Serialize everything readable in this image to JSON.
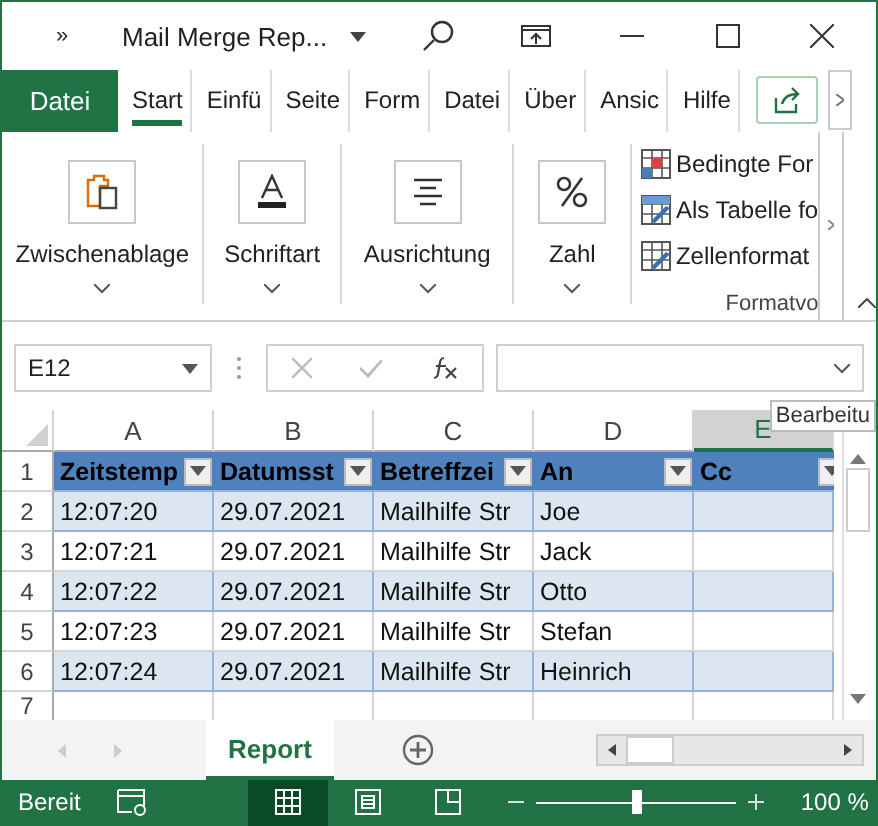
{
  "title_bar": {
    "overflow": "»",
    "title": "Mail Merge Rep..."
  },
  "ribbon_tabs": [
    {
      "label": "Datei",
      "kind": "file",
      "selected": false
    },
    {
      "label": "Start",
      "kind": "tab",
      "selected": true
    },
    {
      "label": "Einfü",
      "kind": "tab",
      "selected": false
    },
    {
      "label": "Seite",
      "kind": "tab",
      "selected": false
    },
    {
      "label": "Form",
      "kind": "tab",
      "selected": false
    },
    {
      "label": "Datei",
      "kind": "tab",
      "selected": false
    },
    {
      "label": "Über",
      "kind": "tab",
      "selected": false
    },
    {
      "label": "Ansic",
      "kind": "tab",
      "selected": false
    },
    {
      "label": "Hilfe",
      "kind": "tab",
      "selected": false
    }
  ],
  "ribbon_groups": [
    {
      "label": "Zwischenablage",
      "kind": "clipboard"
    },
    {
      "label": "Schriftart",
      "kind": "font"
    },
    {
      "label": "Ausrichtung",
      "kind": "alignment"
    },
    {
      "label": "Zahl",
      "kind": "number"
    }
  ],
  "styles_group": {
    "label": "Formatvo",
    "items": [
      {
        "label": "Bedingte For",
        "kind": "conditional"
      },
      {
        "label": "Als Tabelle fo",
        "kind": "table"
      },
      {
        "label": "Zellenformat",
        "kind": "cell"
      }
    ]
  },
  "formula_bar": {
    "name_box": "E12",
    "tooltip": "Bearbeitu"
  },
  "columns": [
    {
      "label": "A",
      "selected": false
    },
    {
      "label": "B",
      "selected": false
    },
    {
      "label": "C",
      "selected": false
    },
    {
      "label": "D",
      "selected": false
    },
    {
      "label": "E",
      "selected": true
    }
  ],
  "table": {
    "headers": [
      "Zeitstemp",
      "Datumsst",
      "Betreffzei",
      "An",
      "Cc"
    ],
    "rows": [
      {
        "number": "1",
        "kind": "header"
      },
      {
        "number": "2",
        "kind": "data",
        "cells": [
          "12:07:20",
          "29.07.2021",
          "Mailhilfe Str",
          "Joe",
          ""
        ]
      },
      {
        "number": "3",
        "kind": "data",
        "cells": [
          "12:07:21",
          "29.07.2021",
          "Mailhilfe Str",
          "Jack",
          ""
        ]
      },
      {
        "number": "4",
        "kind": "data",
        "cells": [
          "12:07:22",
          "29.07.2021",
          "Mailhilfe Str",
          "Otto",
          ""
        ]
      },
      {
        "number": "5",
        "kind": "data",
        "cells": [
          "12:07:23",
          "29.07.2021",
          "Mailhilfe Str",
          "Stefan",
          ""
        ]
      },
      {
        "number": "6",
        "kind": "data",
        "cells": [
          "12:07:24",
          "29.07.2021",
          "Mailhilfe Str",
          "Heinrich",
          ""
        ]
      },
      {
        "number": "7",
        "kind": "empty"
      }
    ]
  },
  "sheet_tabs": [
    {
      "label": "Report",
      "selected": true
    }
  ],
  "status_bar": {
    "status": "Bereit",
    "views": [
      {
        "kind": "normal",
        "selected": true
      },
      {
        "kind": "layout",
        "selected": false
      },
      {
        "kind": "pagebreak",
        "selected": false
      }
    ],
    "zoom": {
      "level": 0.5,
      "reading": "100 %"
    }
  }
}
